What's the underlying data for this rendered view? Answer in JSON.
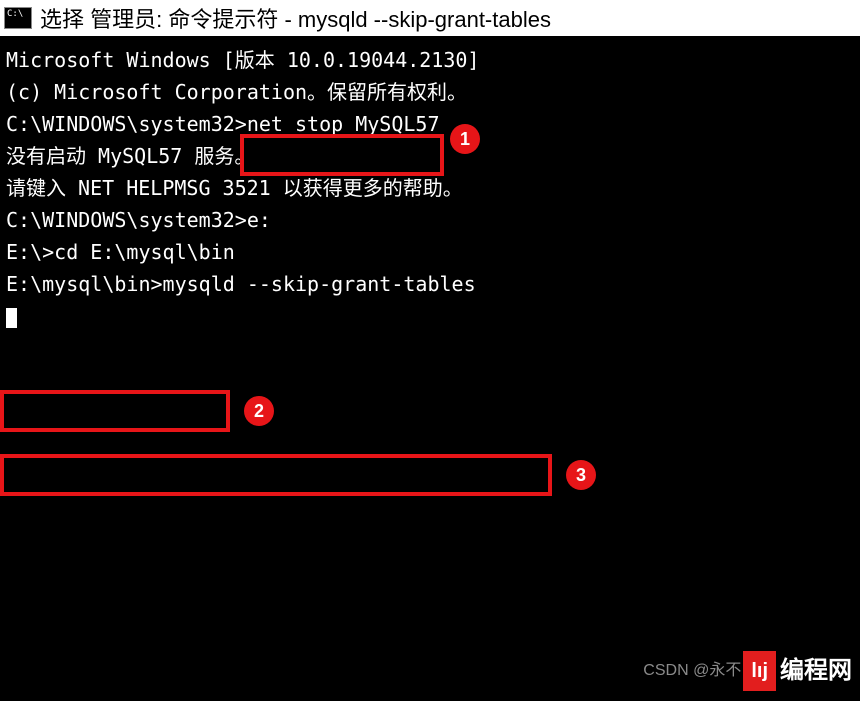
{
  "title_bar": {
    "title": "选择 管理员: 命令提示符 - mysqld  --skip-grant-tables"
  },
  "terminal": {
    "line1": "Microsoft Windows [版本 10.0.19044.2130]",
    "line2": "(c) Microsoft Corporation。保留所有权利。",
    "line3": "",
    "line4_prompt": "C:\\WINDOWS\\system32>",
    "line4_cmd": "net stop MySQL57",
    "line5": "没有启动 MySQL57 服务。",
    "line6": "",
    "line7": "请键入 NET HELPMSG 3521 以获得更多的帮助。",
    "line8": "",
    "line9": "",
    "line10": "C:\\WINDOWS\\system32>e:",
    "line11": "",
    "line12_prompt": "E:\\>",
    "line12_cmd": "cd E:\\mysql\\bin",
    "line13": "",
    "line14_prompt": "E:\\mysql\\bin>",
    "line14_cmd": "mysqld --skip-grant-tables"
  },
  "annotations": {
    "badge1": "1",
    "badge2": "2",
    "badge3": "3"
  },
  "watermark": {
    "prefix": "CSDN @永不",
    "logo": "lıj",
    "brand": "编程网"
  }
}
